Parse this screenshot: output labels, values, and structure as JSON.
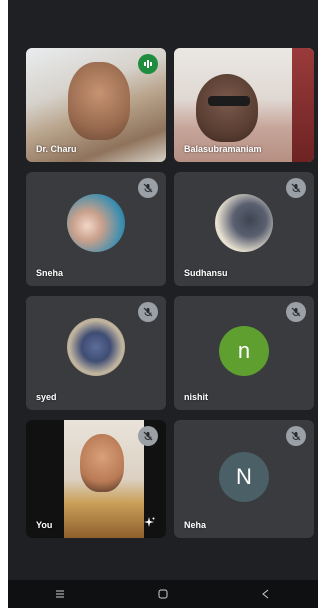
{
  "participants": [
    {
      "name": "Dr. Charu",
      "state": "speaking-video",
      "icon": "audio-level-icon"
    },
    {
      "name": "Balasubramaniam",
      "state": "video",
      "icon": ""
    },
    {
      "name": "Sneha",
      "state": "muted",
      "icon": "mic-off-icon"
    },
    {
      "name": "Sudhansu",
      "state": "muted",
      "icon": "mic-off-icon"
    },
    {
      "name": "syed",
      "state": "muted",
      "icon": "mic-off-icon"
    },
    {
      "name": "nishit",
      "state": "muted",
      "avatar_letter": "n",
      "avatar_color": "#5f9f2f",
      "icon": "mic-off-icon"
    },
    {
      "name": "You",
      "state": "muted-video",
      "icon": "mic-off-icon",
      "extra_icon": "effects-sparkle-icon"
    },
    {
      "name": "Neha",
      "state": "muted",
      "avatar_letter": "N",
      "avatar_color": "#4a5f66",
      "icon": "mic-off-icon"
    }
  ],
  "colors": {
    "background": "#1f2023",
    "tile": "#3a3b3e",
    "speaking": "#1e8e3e",
    "mute_badge": "#9aa0a6"
  },
  "navigation": {
    "buttons": [
      "recents-icon",
      "home-icon",
      "back-icon"
    ]
  }
}
